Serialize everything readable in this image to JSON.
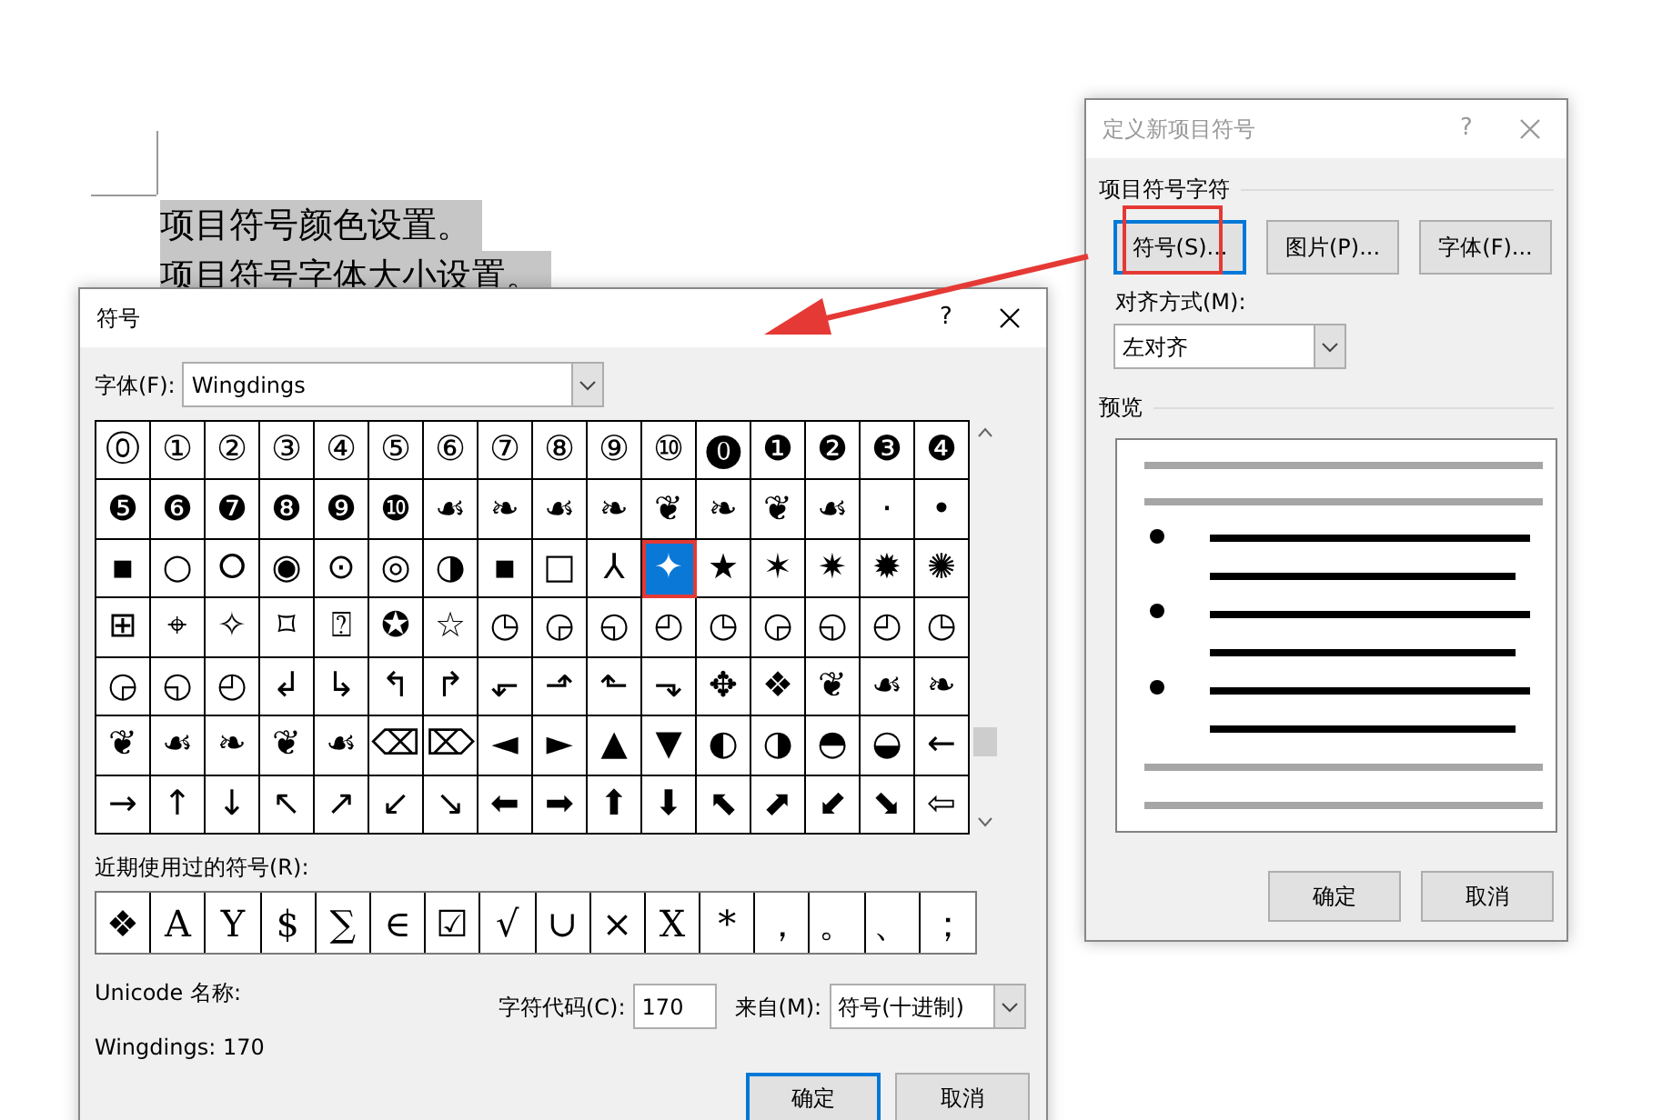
{
  "document": {
    "lines": [
      {
        "text": "项目符号颜色设置。",
        "highlighted": true
      },
      {
        "text": "项目符号字体大小设置。",
        "highlighted": true
      }
    ]
  },
  "symbol_dialog": {
    "title": "符号",
    "help": "?",
    "font_label": "字体(F):",
    "font_value": "Wingdings",
    "symbol_rows": [
      [
        {
          "char": "⓪",
          "selected": false
        },
        {
          "char": "①",
          "selected": false
        },
        {
          "char": "②",
          "selected": false
        },
        {
          "char": "③",
          "selected": false
        },
        {
          "char": "④",
          "selected": false
        },
        {
          "char": "⑤",
          "selected": false
        },
        {
          "char": "⑥",
          "selected": false
        },
        {
          "char": "⑦",
          "selected": false
        },
        {
          "char": "⑧",
          "selected": false
        },
        {
          "char": "⑨",
          "selected": false
        },
        {
          "char": "⑩",
          "selected": false
        },
        {
          "char": "⓿",
          "selected": false
        },
        {
          "char": "❶",
          "selected": false
        },
        {
          "char": "❷",
          "selected": false
        },
        {
          "char": "❸",
          "selected": false
        },
        {
          "char": "❹",
          "selected": false
        }
      ],
      [
        {
          "char": "❺",
          "selected": false
        },
        {
          "char": "❻",
          "selected": false
        },
        {
          "char": "❼",
          "selected": false
        },
        {
          "char": "❽",
          "selected": false
        },
        {
          "char": "❾",
          "selected": false
        },
        {
          "char": "❿",
          "selected": false
        },
        {
          "char": "☙",
          "selected": false
        },
        {
          "char": "❧",
          "selected": false
        },
        {
          "char": "☙",
          "selected": false
        },
        {
          "char": "❧",
          "selected": false
        },
        {
          "char": "❦",
          "selected": false
        },
        {
          "char": "❧",
          "selected": false
        },
        {
          "char": "❦",
          "selected": false
        },
        {
          "char": "☙",
          "selected": false
        },
        {
          "char": "·",
          "selected": false
        },
        {
          "char": "•",
          "selected": false
        }
      ],
      [
        {
          "char": "▪",
          "selected": false
        },
        {
          "char": "○",
          "selected": false
        },
        {
          "char": "⭘",
          "selected": false
        },
        {
          "char": "◉",
          "selected": false
        },
        {
          "char": "⊙",
          "selected": false
        },
        {
          "char": "◎",
          "selected": false
        },
        {
          "char": "◑",
          "selected": false
        },
        {
          "char": "▪",
          "selected": false
        },
        {
          "char": "□",
          "selected": false
        },
        {
          "char": "⅄",
          "selected": false
        },
        {
          "char": "✦",
          "selected": true
        },
        {
          "char": "★",
          "selected": false
        },
        {
          "char": "✶",
          "selected": false
        },
        {
          "char": "✷",
          "selected": false
        },
        {
          "char": "✹",
          "selected": false
        },
        {
          "char": "✺",
          "selected": false
        }
      ],
      [
        {
          "char": "⊞",
          "selected": false
        },
        {
          "char": "⌖",
          "selected": false
        },
        {
          "char": "✧",
          "selected": false
        },
        {
          "char": "⌑",
          "selected": false
        },
        {
          "char": "⍰",
          "selected": false
        },
        {
          "char": "✪",
          "selected": false
        },
        {
          "char": "☆",
          "selected": false
        },
        {
          "char": "◷",
          "selected": false
        },
        {
          "char": "◶",
          "selected": false
        },
        {
          "char": "◵",
          "selected": false
        },
        {
          "char": "◴",
          "selected": false
        },
        {
          "char": "◷",
          "selected": false
        },
        {
          "char": "◶",
          "selected": false
        },
        {
          "char": "◵",
          "selected": false
        },
        {
          "char": "◴",
          "selected": false
        },
        {
          "char": "◷",
          "selected": false
        }
      ],
      [
        {
          "char": "◶",
          "selected": false
        },
        {
          "char": "◵",
          "selected": false
        },
        {
          "char": "◴",
          "selected": false
        },
        {
          "char": "↲",
          "selected": false
        },
        {
          "char": "↳",
          "selected": false
        },
        {
          "char": "↰",
          "selected": false
        },
        {
          "char": "↱",
          "selected": false
        },
        {
          "char": "⬐",
          "selected": false
        },
        {
          "char": "⬏",
          "selected": false
        },
        {
          "char": "⬑",
          "selected": false
        },
        {
          "char": "⬎",
          "selected": false
        },
        {
          "char": "✥",
          "selected": false
        },
        {
          "char": "❖",
          "selected": false
        },
        {
          "char": "❦",
          "selected": false
        },
        {
          "char": "☙",
          "selected": false
        },
        {
          "char": "❧",
          "selected": false
        }
      ],
      [
        {
          "char": "❦",
          "selected": false
        },
        {
          "char": "☙",
          "selected": false
        },
        {
          "char": "❧",
          "selected": false
        },
        {
          "char": "❦",
          "selected": false
        },
        {
          "char": "☙",
          "selected": false
        },
        {
          "char": "⌫",
          "selected": false
        },
        {
          "char": "⌦",
          "selected": false
        },
        {
          "char": "◄",
          "selected": false
        },
        {
          "char": "►",
          "selected": false
        },
        {
          "char": "▲",
          "selected": false
        },
        {
          "char": "▼",
          "selected": false
        },
        {
          "char": "◐",
          "selected": false
        },
        {
          "char": "◑",
          "selected": false
        },
        {
          "char": "◓",
          "selected": false
        },
        {
          "char": "◒",
          "selected": false
        },
        {
          "char": "←",
          "selected": false
        }
      ],
      [
        {
          "char": "→",
          "selected": false
        },
        {
          "char": "↑",
          "selected": false
        },
        {
          "char": "↓",
          "selected": false
        },
        {
          "char": "↖",
          "selected": false
        },
        {
          "char": "↗",
          "selected": false
        },
        {
          "char": "↙",
          "selected": false
        },
        {
          "char": "↘",
          "selected": false
        },
        {
          "char": "⬅",
          "selected": false
        },
        {
          "char": "➡",
          "selected": false
        },
        {
          "char": "⬆",
          "selected": false
        },
        {
          "char": "⬇",
          "selected": false
        },
        {
          "char": "⬉",
          "selected": false
        },
        {
          "char": "⬈",
          "selected": false
        },
        {
          "char": "⬋",
          "selected": false
        },
        {
          "char": "⬊",
          "selected": false
        },
        {
          "char": "⇦",
          "selected": false
        }
      ]
    ],
    "recent_label": "近期使用过的符号(R):",
    "recent": [
      "❖",
      "A",
      "Y",
      "$",
      "∑",
      "∈",
      "☑",
      "√",
      "∪",
      "×",
      "X",
      "*",
      "，",
      "。",
      "、",
      "；"
    ],
    "unicode_name_label": "Unicode 名称:",
    "char_info": "Wingdings: 170",
    "code_label": "字符代码(C):",
    "code_value": "170",
    "from_label": "来自(M):",
    "from_value": "符号(十进制)",
    "buttons": [
      {
        "label": "确定",
        "default": true
      },
      {
        "label": "取消",
        "default": false
      }
    ]
  },
  "bullet_dialog": {
    "title": "定义新项目符号",
    "active": false,
    "help": "?",
    "group_label": "项目符号字符",
    "char_buttons": [
      {
        "label": "符号(S)...",
        "focused": true
      },
      {
        "label": "图片(P)...",
        "focused": false
      },
      {
        "label": "字体(F)...",
        "focused": false
      }
    ],
    "align_label": "对齐方式(M):",
    "align_value": "左对齐",
    "preview_label": "预览",
    "buttons": [
      {
        "label": "确定",
        "default": false
      },
      {
        "label": "取消",
        "default": false
      }
    ]
  }
}
